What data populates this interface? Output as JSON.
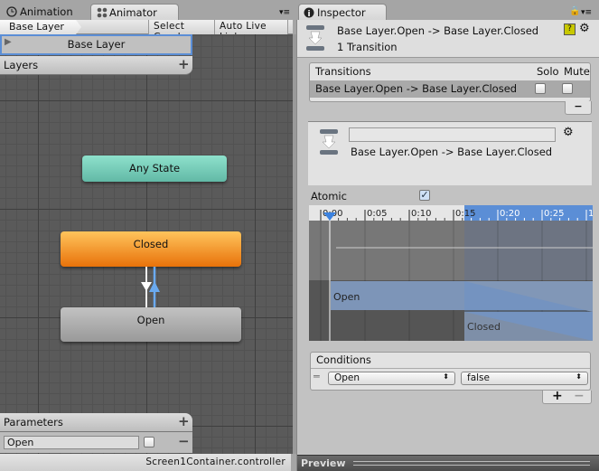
{
  "left_tabs": [
    {
      "label": "Animation",
      "icon": "clock-icon"
    },
    {
      "label": "Animator",
      "icon": "animator-icon",
      "active": true
    }
  ],
  "toolbar": {
    "breadcrumb": "Base Layer",
    "select_graph": "Select Graph",
    "auto_live_link": "Auto Live Link"
  },
  "layers": {
    "header": "Layers",
    "items": [
      {
        "label": "Base Layer",
        "selected": true
      }
    ],
    "add": "+"
  },
  "states": {
    "any_state": "Any State",
    "closed": "Closed",
    "open": "Open"
  },
  "parameters": {
    "header": "Parameters",
    "add": "+",
    "remove": "−",
    "items": [
      {
        "name": "Open",
        "value": false
      }
    ]
  },
  "status_bar": "Screen1Container.controller",
  "inspector": {
    "tab": "Inspector",
    "title": "Base Layer.Open -> Base Layer.Closed",
    "subtitle": "1 Transition",
    "transitions": {
      "header": "Transitions",
      "solo": "Solo",
      "mute": "Mute",
      "rows": [
        {
          "name": "Base Layer.Open -> Base Layer.Closed",
          "solo": false,
          "mute": false
        }
      ],
      "remove": "−"
    },
    "detail": {
      "name_value": "",
      "label": "Base Layer.Open -> Base Layer.Closed"
    },
    "atomic": {
      "label": "Atomic",
      "checked": true
    },
    "timeline": {
      "ticks": [
        "0:00",
        "0:05",
        "0:10",
        "0:15",
        "0:20",
        "0:25",
        "1"
      ],
      "source_state": "Open",
      "dest_state": "Closed"
    },
    "conditions": {
      "header": "Conditions",
      "rows": [
        {
          "parameter": "Open",
          "value": "false"
        }
      ],
      "add": "+",
      "remove": "−"
    },
    "preview": "Preview"
  },
  "colors": {
    "any_state": "#6fc9b5",
    "closed": "#f0900c",
    "open": "#a8a8a8",
    "selection": "#5b8ed6"
  }
}
